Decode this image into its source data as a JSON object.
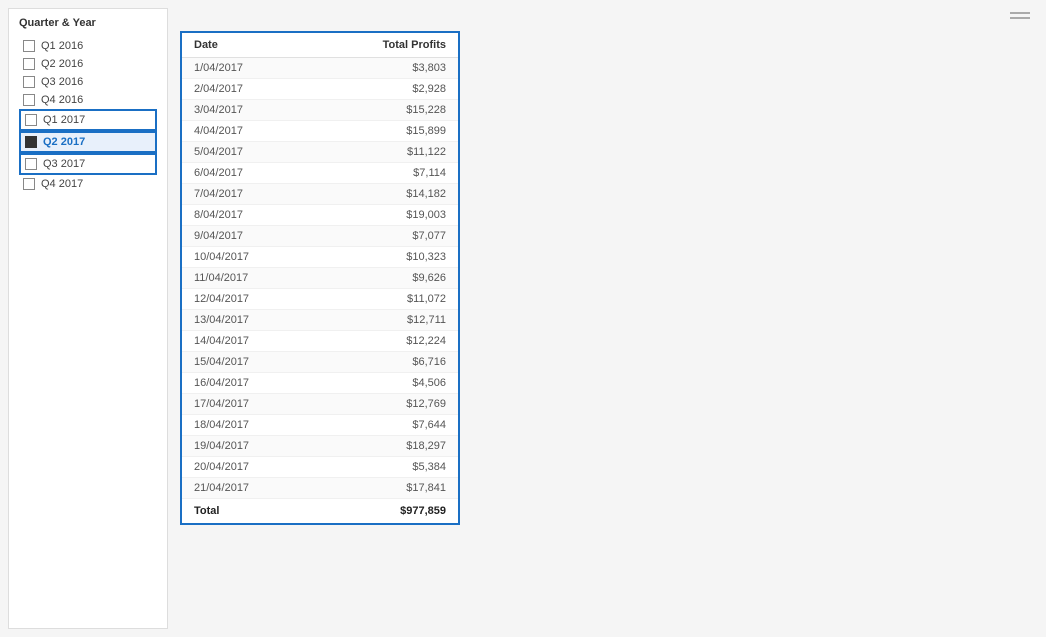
{
  "sidebar": {
    "title": "Quarter & Year",
    "items": [
      {
        "id": "q1-2016",
        "label": "Q1 2016",
        "checked": false,
        "selected": false,
        "highlighted": false
      },
      {
        "id": "q2-2016",
        "label": "Q2 2016",
        "checked": false,
        "selected": false,
        "highlighted": false
      },
      {
        "id": "q3-2016",
        "label": "Q3 2016",
        "checked": false,
        "selected": false,
        "highlighted": false
      },
      {
        "id": "q4-2016",
        "label": "Q4 2016",
        "checked": false,
        "selected": false,
        "highlighted": false
      },
      {
        "id": "q1-2017",
        "label": "Q1 2017",
        "checked": false,
        "selected": false,
        "highlighted": true
      },
      {
        "id": "q2-2017",
        "label": "Q2 2017",
        "checked": true,
        "selected": true,
        "highlighted": false
      },
      {
        "id": "q3-2017",
        "label": "Q3 2017",
        "checked": false,
        "selected": false,
        "highlighted": true
      },
      {
        "id": "q4-2017",
        "label": "Q4 2017",
        "checked": false,
        "selected": false,
        "highlighted": false
      }
    ]
  },
  "table": {
    "col_date": "Date",
    "col_profits": "Total Profits",
    "rows": [
      {
        "date": "1/04/2017",
        "profit": "$3,803"
      },
      {
        "date": "2/04/2017",
        "profit": "$2,928"
      },
      {
        "date": "3/04/2017",
        "profit": "$15,228"
      },
      {
        "date": "4/04/2017",
        "profit": "$15,899"
      },
      {
        "date": "5/04/2017",
        "profit": "$11,122"
      },
      {
        "date": "6/04/2017",
        "profit": "$7,114"
      },
      {
        "date": "7/04/2017",
        "profit": "$14,182"
      },
      {
        "date": "8/04/2017",
        "profit": "$19,003"
      },
      {
        "date": "9/04/2017",
        "profit": "$7,077"
      },
      {
        "date": "10/04/2017",
        "profit": "$10,323"
      },
      {
        "date": "11/04/2017",
        "profit": "$9,626"
      },
      {
        "date": "12/04/2017",
        "profit": "$11,072"
      },
      {
        "date": "13/04/2017",
        "profit": "$12,711"
      },
      {
        "date": "14/04/2017",
        "profit": "$12,224"
      },
      {
        "date": "15/04/2017",
        "profit": "$6,716"
      },
      {
        "date": "16/04/2017",
        "profit": "$4,506"
      },
      {
        "date": "17/04/2017",
        "profit": "$12,769"
      },
      {
        "date": "18/04/2017",
        "profit": "$7,644"
      },
      {
        "date": "19/04/2017",
        "profit": "$18,297"
      },
      {
        "date": "20/04/2017",
        "profit": "$5,384"
      },
      {
        "date": "21/04/2017",
        "profit": "$17,841"
      }
    ],
    "total_label": "Total",
    "total_value": "$977,859"
  },
  "topbar": {
    "drag_handle": "drag-handle"
  }
}
